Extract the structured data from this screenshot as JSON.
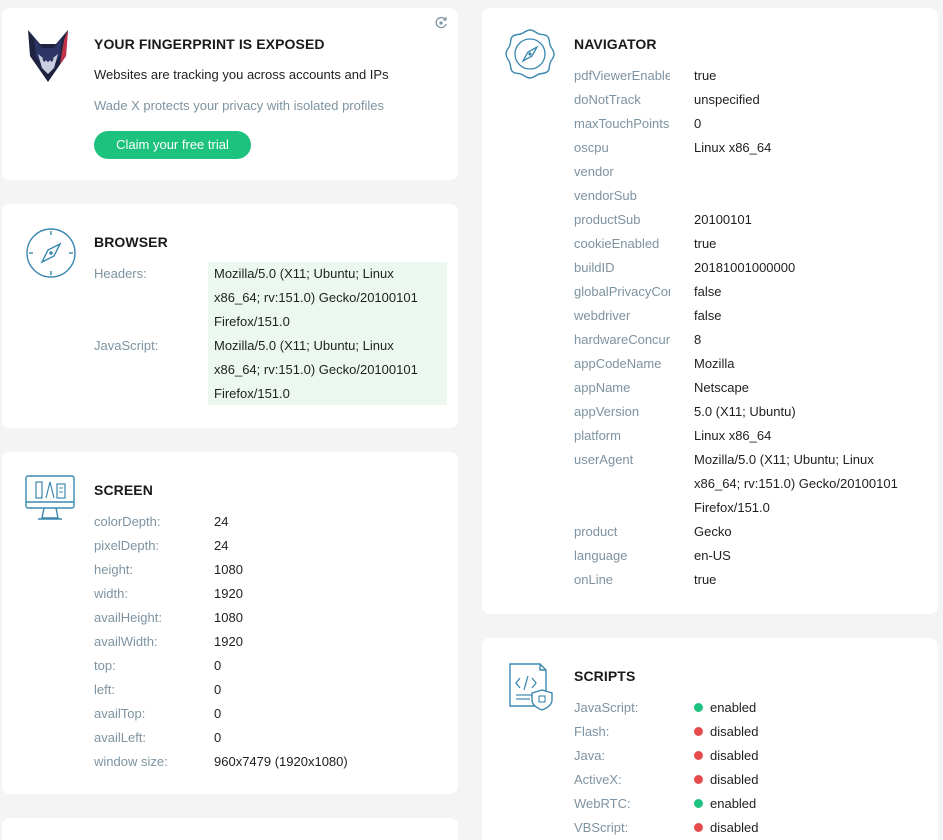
{
  "promo": {
    "title": "YOUR FINGERPRINT IS EXPOSED",
    "subtitle": "Websites are tracking you across accounts and IPs",
    "tagline": "Wade X protects your privacy with isolated profiles",
    "cta_label": "Claim your free trial"
  },
  "browser": {
    "title": "BROWSER",
    "rows": [
      {
        "key": "Headers:",
        "value": "Mozilla/5.0 (X11; Ubuntu; Linux x86_64; rv:151.0) Gecko/20100101 Firefox/151.0"
      },
      {
        "key": "JavaScript:",
        "value": "Mozilla/5.0 (X11; Ubuntu; Linux x86_64; rv:151.0) Gecko/20100101 Firefox/151.0"
      }
    ]
  },
  "screen": {
    "title": "SCREEN",
    "rows": [
      {
        "key": "colorDepth:",
        "value": "24"
      },
      {
        "key": "pixelDepth:",
        "value": "24"
      },
      {
        "key": "height:",
        "value": "1080"
      },
      {
        "key": "width:",
        "value": "1920"
      },
      {
        "key": "availHeight:",
        "value": "1080"
      },
      {
        "key": "availWidth:",
        "value": "1920"
      },
      {
        "key": "top:",
        "value": "0"
      },
      {
        "key": "left:",
        "value": "0"
      },
      {
        "key": "availTop:",
        "value": "0"
      },
      {
        "key": "availLeft:",
        "value": "0"
      },
      {
        "key": "window size:",
        "value": "960x7479 (1920x1080)"
      }
    ]
  },
  "navigator": {
    "title": "NAVIGATOR",
    "rows": [
      {
        "key": "pdfViewerEnabled",
        "value": "true"
      },
      {
        "key": "doNotTrack",
        "value": "unspecified"
      },
      {
        "key": "maxTouchPoints",
        "value": "0"
      },
      {
        "key": "oscpu",
        "value": "Linux x86_64"
      },
      {
        "key": "vendor",
        "value": ""
      },
      {
        "key": "vendorSub",
        "value": ""
      },
      {
        "key": "productSub",
        "value": "20100101"
      },
      {
        "key": "cookieEnabled",
        "value": "true"
      },
      {
        "key": "buildID",
        "value": "20181001000000"
      },
      {
        "key": "globalPrivacyControl",
        "value": "false"
      },
      {
        "key": "webdriver",
        "value": "false"
      },
      {
        "key": "hardwareConcurrency",
        "value": "8"
      },
      {
        "key": "appCodeName",
        "value": "Mozilla"
      },
      {
        "key": "appName",
        "value": "Netscape"
      },
      {
        "key": "appVersion",
        "value": "5.0 (X11; Ubuntu)"
      },
      {
        "key": "platform",
        "value": "Linux x86_64"
      },
      {
        "key": "userAgent",
        "value": "Mozilla/5.0 (X11; Ubuntu; Linux x86_64; rv:151.0) Gecko/20100101 Firefox/151.0"
      },
      {
        "key": "product",
        "value": "Gecko"
      },
      {
        "key": "language",
        "value": "en-US"
      },
      {
        "key": "onLine",
        "value": "true"
      }
    ]
  },
  "scripts": {
    "title": "SCRIPTS",
    "colors": {
      "enabled": "#1ec27f",
      "disabled": "#e54b4b"
    },
    "rows": [
      {
        "key": "JavaScript:",
        "value": "enabled",
        "status": "enabled"
      },
      {
        "key": "Flash:",
        "value": "disabled",
        "status": "disabled"
      },
      {
        "key": "Java:",
        "value": "disabled",
        "status": "disabled"
      },
      {
        "key": "ActiveX:",
        "value": "disabled",
        "status": "disabled"
      },
      {
        "key": "WebRTC:",
        "value": "enabled",
        "status": "enabled"
      },
      {
        "key": "VBScript:",
        "value": "disabled",
        "status": "disabled"
      }
    ]
  },
  "icons": {
    "refresh": "refresh-icon",
    "logo": "wolf-logo-icon",
    "browser": "compass-icon",
    "screen": "monitor-icon",
    "navigator": "compass-badge-icon",
    "scripts": "script-document-icon"
  }
}
